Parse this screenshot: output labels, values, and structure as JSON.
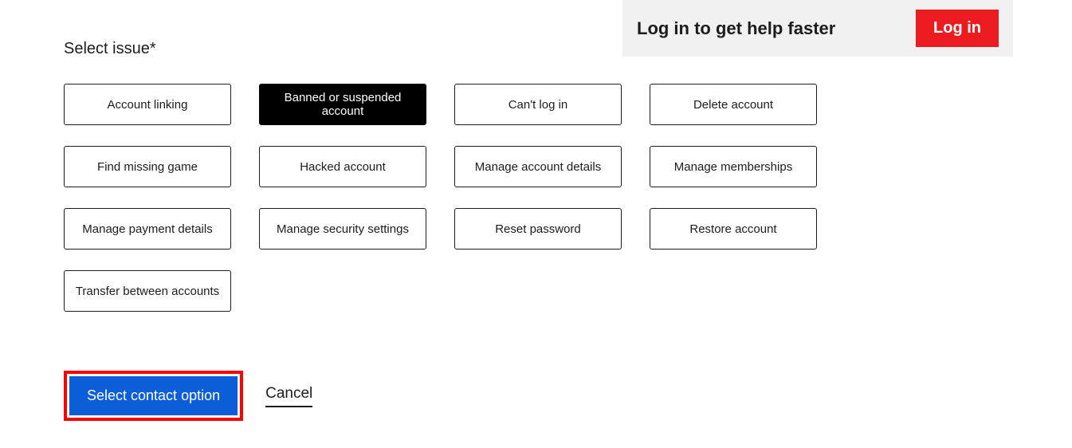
{
  "banner": {
    "text": "Log in to get help faster",
    "button": "Log in"
  },
  "heading": "Select issue*",
  "issues": [
    {
      "label": "Account linking",
      "selected": false
    },
    {
      "label": "Banned or suspended account",
      "selected": true
    },
    {
      "label": "Can't log in",
      "selected": false
    },
    {
      "label": "Delete account",
      "selected": false
    },
    {
      "label": "Find missing game",
      "selected": false
    },
    {
      "label": "Hacked account",
      "selected": false
    },
    {
      "label": "Manage account details",
      "selected": false
    },
    {
      "label": "Manage memberships",
      "selected": false
    },
    {
      "label": "Manage payment details",
      "selected": false
    },
    {
      "label": "Manage security settings",
      "selected": false
    },
    {
      "label": "Reset password",
      "selected": false
    },
    {
      "label": "Restore account",
      "selected": false
    },
    {
      "label": "Transfer between accounts",
      "selected": false
    }
  ],
  "actions": {
    "primary": "Select contact option",
    "cancel": "Cancel"
  }
}
